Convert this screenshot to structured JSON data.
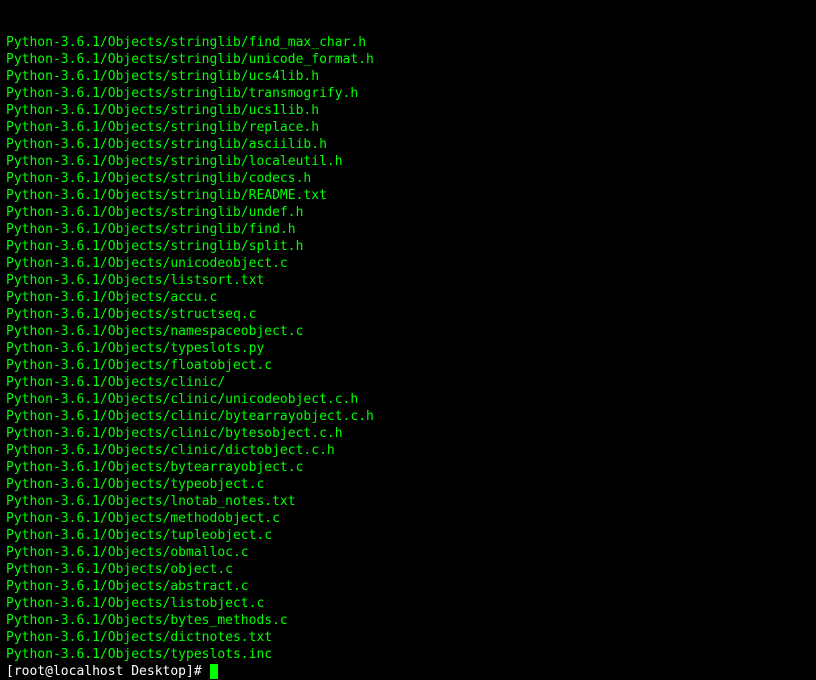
{
  "output_lines": [
    "Python-3.6.1/Objects/stringlib/find_max_char.h",
    "Python-3.6.1/Objects/stringlib/unicode_format.h",
    "Python-3.6.1/Objects/stringlib/ucs4lib.h",
    "Python-3.6.1/Objects/stringlib/transmogrify.h",
    "Python-3.6.1/Objects/stringlib/ucs1lib.h",
    "Python-3.6.1/Objects/stringlib/replace.h",
    "Python-3.6.1/Objects/stringlib/asciilib.h",
    "Python-3.6.1/Objects/stringlib/localeutil.h",
    "Python-3.6.1/Objects/stringlib/codecs.h",
    "Python-3.6.1/Objects/stringlib/README.txt",
    "Python-3.6.1/Objects/stringlib/undef.h",
    "Python-3.6.1/Objects/stringlib/find.h",
    "Python-3.6.1/Objects/stringlib/split.h",
    "Python-3.6.1/Objects/unicodeobject.c",
    "Python-3.6.1/Objects/listsort.txt",
    "Python-3.6.1/Objects/accu.c",
    "Python-3.6.1/Objects/structseq.c",
    "Python-3.6.1/Objects/namespaceobject.c",
    "Python-3.6.1/Objects/typeslots.py",
    "Python-3.6.1/Objects/floatobject.c",
    "Python-3.6.1/Objects/clinic/",
    "Python-3.6.1/Objects/clinic/unicodeobject.c.h",
    "Python-3.6.1/Objects/clinic/bytearrayobject.c.h",
    "Python-3.6.1/Objects/clinic/bytesobject.c.h",
    "Python-3.6.1/Objects/clinic/dictobject.c.h",
    "Python-3.6.1/Objects/bytearrayobject.c",
    "Python-3.6.1/Objects/typeobject.c",
    "Python-3.6.1/Objects/lnotab_notes.txt",
    "Python-3.6.1/Objects/methodobject.c",
    "Python-3.6.1/Objects/tupleobject.c",
    "Python-3.6.1/Objects/obmalloc.c",
    "Python-3.6.1/Objects/object.c",
    "Python-3.6.1/Objects/abstract.c",
    "Python-3.6.1/Objects/listobject.c",
    "Python-3.6.1/Objects/bytes_methods.c",
    "Python-3.6.1/Objects/dictnotes.txt",
    "Python-3.6.1/Objects/typeslots.inc"
  ],
  "prompt": "[root@localhost Desktop]# "
}
